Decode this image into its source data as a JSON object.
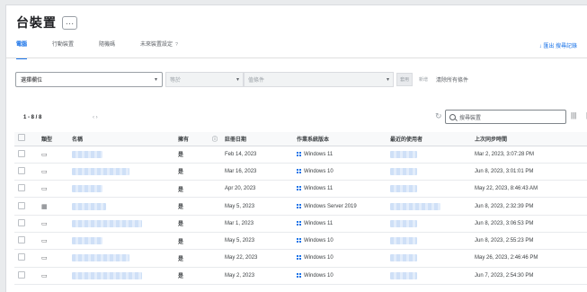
{
  "page": {
    "title": "台裝置",
    "more_label": "…",
    "tabs": [
      {
        "label": "電腦",
        "active": true
      },
      {
        "label": "行動裝置",
        "active": false
      },
      {
        "label": "隨機碼",
        "active": false
      },
      {
        "label": "未來裝置設定",
        "active": false,
        "sup": "?"
      }
    ],
    "tab_right": "↓ 匯出 搜尋記錄"
  },
  "filters": {
    "filter_select": "選擇欄位",
    "operator_select": "等於",
    "value_select": "值條件",
    "apply": "套用",
    "or_label": "新增",
    "clear": "清除所有條件"
  },
  "toolbar": {
    "count": "1 - 8 / 8",
    "loading": "‹  ›",
    "refresh": "↻",
    "search_placeholder": "搜尋裝置",
    "columns_icon": "|||",
    "density_icon": "|||"
  },
  "table": {
    "headers": [
      "",
      "類型",
      "名稱",
      "擁有",
      "",
      "註冊日期",
      "作業系統版本",
      "最近的使用者",
      "上次同步時間"
    ],
    "rows": [
      {
        "icon": "laptop",
        "name_w": 34,
        "owner": "是",
        "date": "Feb 14, 2023",
        "os": "Windows 11",
        "user_w": 30,
        "sync": "Mar 2, 2023, 3:07:28 PM"
      },
      {
        "icon": "laptop",
        "name_w": 64,
        "owner": "是",
        "date": "Mar 16, 2023",
        "os": "Windows 10",
        "user_w": 30,
        "sync": "Jun 8, 2023, 3:01:01 PM"
      },
      {
        "icon": "laptop",
        "name_w": 34,
        "owner": "是",
        "date": "Apr 20, 2023",
        "os": "Windows 11",
        "user_w": 30,
        "sync": "May 22, 2023, 8:46:43 AM"
      },
      {
        "icon": "desktop",
        "name_w": 38,
        "owner": "是",
        "date": "May 5, 2023",
        "os": "Windows Server 2019",
        "user_w": 56,
        "sync": "Jun 8, 2023, 2:32:39 PM"
      },
      {
        "icon": "laptop",
        "name_w": 78,
        "owner": "是",
        "date": "Mar 1, 2023",
        "os": "Windows 11",
        "user_w": 30,
        "sync": "Jun 8, 2023, 3:06:53 PM"
      },
      {
        "icon": "laptop",
        "name_w": 34,
        "owner": "是",
        "date": "May 5, 2023",
        "os": "Windows 10",
        "user_w": 30,
        "sync": "Jun 8, 2023, 2:55:23 PM"
      },
      {
        "icon": "laptop",
        "name_w": 64,
        "owner": "是",
        "date": "May 22, 2023",
        "os": "Windows 10",
        "user_w": 30,
        "sync": "May 26, 2023, 2:46:46 PM"
      },
      {
        "icon": "laptop",
        "name_w": 78,
        "owner": "是",
        "date": "May 2, 2023",
        "os": "Windows 10",
        "user_w": 30,
        "sync": "Jun 7, 2023, 2:54:30 PM"
      }
    ]
  }
}
